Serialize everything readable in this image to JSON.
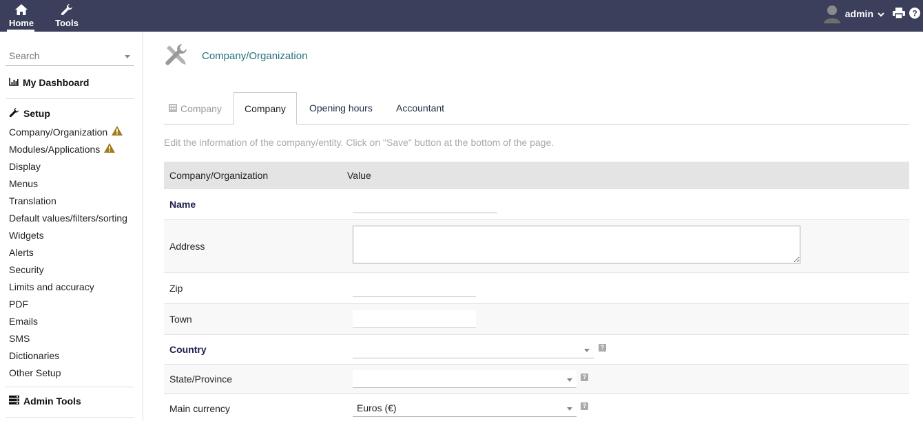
{
  "topbar": {
    "home_label": "Home",
    "tools_label": "Tools",
    "user_name": "admin"
  },
  "sidebar": {
    "search_placeholder": "Search",
    "dashboard_label": "My Dashboard",
    "setup_label": "Setup",
    "items": [
      {
        "label": "Company/Organization",
        "warning": true
      },
      {
        "label": "Modules/Applications",
        "warning": true
      },
      {
        "label": "Display"
      },
      {
        "label": "Menus"
      },
      {
        "label": "Translation"
      },
      {
        "label": "Default values/filters/sorting"
      },
      {
        "label": "Widgets"
      },
      {
        "label": "Alerts"
      },
      {
        "label": "Security"
      },
      {
        "label": "Limits and accuracy"
      },
      {
        "label": "PDF"
      },
      {
        "label": "Emails"
      },
      {
        "label": "SMS"
      },
      {
        "label": "Dictionaries"
      },
      {
        "label": "Other Setup"
      }
    ],
    "admin_tools_label": "Admin Tools"
  },
  "main": {
    "title": "Company/Organization",
    "tabs": [
      {
        "label": "Company"
      },
      {
        "label": "Company"
      },
      {
        "label": "Opening hours"
      },
      {
        "label": "Accountant"
      }
    ],
    "hint": "Edit the information of the company/entity. Click on \"Save\" button at the bottom of the page.",
    "table": {
      "col1": "Company/Organization",
      "col2": "Value",
      "rows": {
        "name": {
          "label": "Name",
          "value": ""
        },
        "address": {
          "label": "Address",
          "value": ""
        },
        "zip": {
          "label": "Zip",
          "value": ""
        },
        "town": {
          "label": "Town",
          "value": ""
        },
        "country": {
          "label": "Country",
          "value": ""
        },
        "state": {
          "label": "State/Province",
          "value": ""
        },
        "currency": {
          "label": "Main currency",
          "value": "Euros (€)"
        }
      }
    }
  },
  "colors": {
    "topbar": "#3b3f5c",
    "title": "#25707b",
    "warning": "#a07d1a"
  }
}
